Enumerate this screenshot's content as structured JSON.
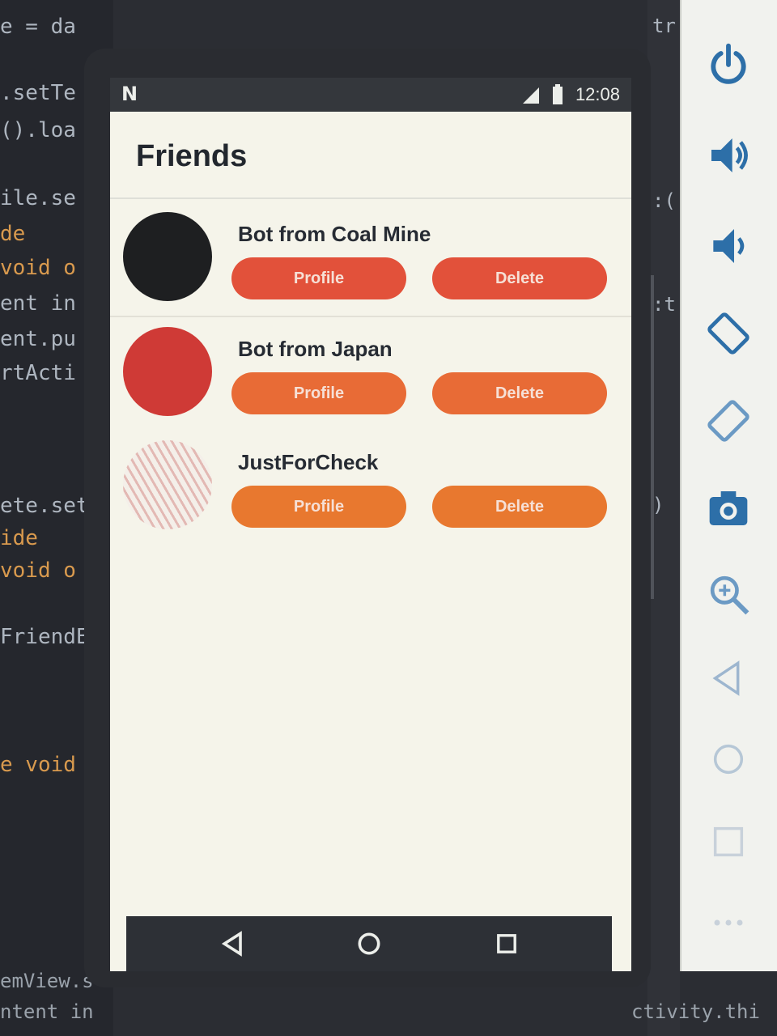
{
  "editor": {
    "left_lines": [
      {
        "text": "e = da",
        "kw": false
      },
      {
        "text": ".setTe",
        "kw": false
      },
      {
        "text": "().loa",
        "kw": false
      },
      {
        "text": "ile.se",
        "kw": false
      },
      {
        "text": "de",
        "kw": true
      },
      {
        "text": "void o",
        "kw": true
      },
      {
        "text": "ent in",
        "kw": false
      },
      {
        "text": "ent.pu",
        "kw": false
      },
      {
        "text": "rtActi",
        "kw": false
      },
      {
        "text": "ete.set",
        "kw": false
      },
      {
        "text": "ide",
        "kw": true
      },
      {
        "text": " void o",
        "kw": true
      },
      {
        "text": "FriendE",
        "kw": false
      },
      {
        "text": "e void",
        "kw": true
      }
    ],
    "right_fragments": [
      "tr",
      ":(",
      ":t",
      ")"
    ],
    "bottom_left": [
      "emView.s",
      "ntent in"
    ],
    "bottom_right": "ctivity.thi"
  },
  "status_bar": {
    "notification_glyph": "N",
    "time": "12:08"
  },
  "app": {
    "title": "Friends",
    "friends": [
      {
        "name": "Bot from Coal Mine",
        "avatar": "black-circle-avatar",
        "avatar_color": "#1e1f21",
        "btn_color": "#e2513a",
        "profile_label": "Profile",
        "delete_label": "Delete"
      },
      {
        "name": "Bot from Japan",
        "avatar": "red-circle-avatar",
        "avatar_color": "#cf3a36",
        "btn_color": "#e86b36",
        "profile_label": "Profile",
        "delete_label": "Delete"
      },
      {
        "name": "JustForCheck",
        "avatar": "striped-pattern-avatar",
        "avatar_color": "#e8c9c4",
        "btn_color": "#e8782f",
        "profile_label": "Profile",
        "delete_label": "Delete"
      }
    ]
  },
  "colors": {
    "screen_bg": "#f5f4ea",
    "status_bg": "#34373c",
    "nav_bg": "#2d3036",
    "toolbar_icon": "#2d6fa8"
  },
  "emulator_toolbar": [
    "power-icon",
    "volume-up-icon",
    "volume-down-icon",
    "rotate-left-icon",
    "rotate-right-icon",
    "camera-icon",
    "zoom-icon",
    "back-icon",
    "home-icon",
    "overview-icon",
    "more-icon"
  ]
}
